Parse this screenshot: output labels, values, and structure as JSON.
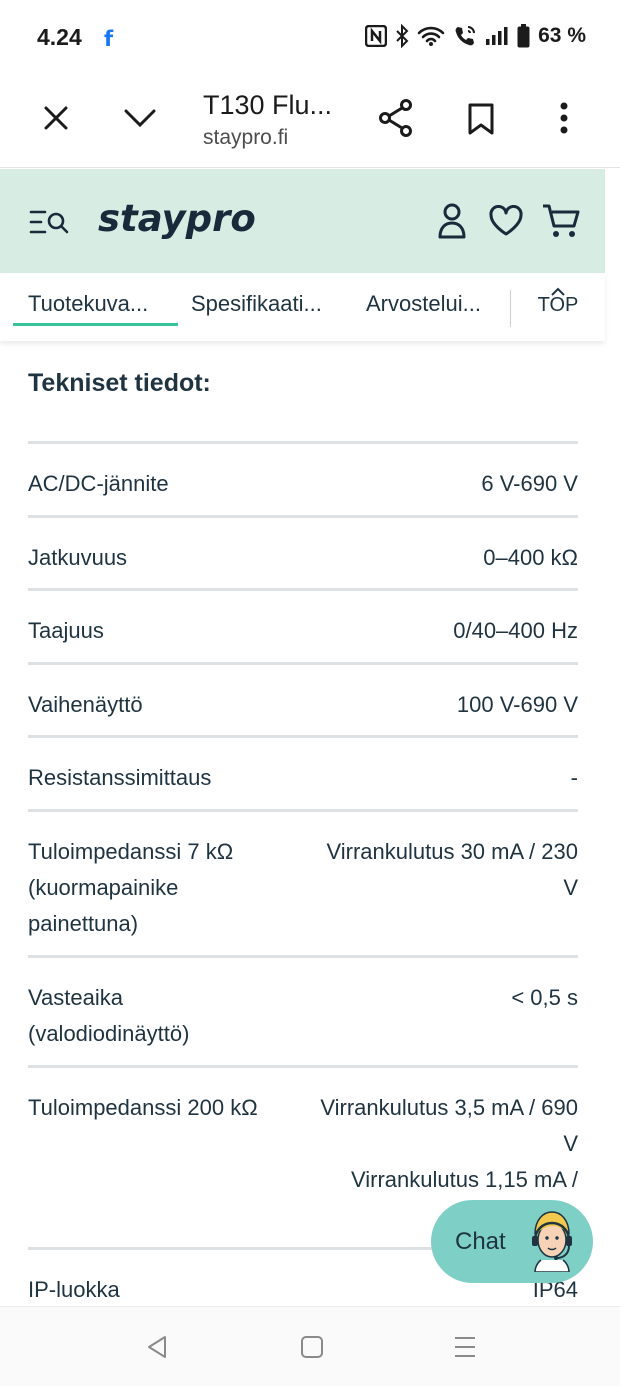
{
  "status_bar": {
    "time": "4.24",
    "app_icon": "facebook-icon",
    "battery": "63 %",
    "icons": [
      "nfc-icon",
      "bluetooth-icon",
      "wifi-icon",
      "wifi-calling-icon",
      "signal-icon",
      "battery-icon"
    ]
  },
  "browser": {
    "title": "T130 Flu...",
    "domain": "staypro.fi",
    "icons": [
      "close-icon",
      "chevron-down-icon",
      "share-icon",
      "bookmark-icon",
      "more-icon"
    ]
  },
  "site": {
    "logo": "staypro",
    "icons": [
      "menu-search-icon",
      "user-icon",
      "heart-icon",
      "cart-icon"
    ],
    "accent": "#37c49a",
    "header_bg": "#d7ece2"
  },
  "tabs": [
    {
      "label": "Tuotekuva..."
    },
    {
      "label": "Spesifikaati..."
    },
    {
      "label": "Arvostelui..."
    }
  ],
  "top_button": "TOP",
  "section_title": "Tekniset tiedot:",
  "specs": [
    {
      "label": "AC/DC-jännite",
      "value": "6 V-690 V"
    },
    {
      "label": "Jatkuvuus",
      "value": "0–400 kΩ"
    },
    {
      "label": "Taajuus",
      "value": "0/40–400 Hz"
    },
    {
      "label": "Vaihenäyttö",
      "value": "100 V-690 V"
    },
    {
      "label": "Resistanssimittaus",
      "value": "-"
    },
    {
      "label": "Tuloimpedanssi 7 kΩ (kuormapainike painettuna)",
      "value": "Virrankulutus 30 mA / 230 V"
    },
    {
      "label": "Vasteaika (valodiodinäyttö)",
      "value": "< 0,5 s"
    },
    {
      "label": "Tuloimpedanssi 200 kΩ",
      "value": "Virrankulutus 3,5 mA / 690 V",
      "value2": "Virrankulutus 1,15 mA /"
    },
    {
      "label": "IP-luokka",
      "value": "IP64"
    }
  ],
  "chat": {
    "label": "Chat",
    "icon": "support-agent-avatar"
  },
  "nav_bar": {
    "icons": [
      "back-icon",
      "home-icon",
      "recents-icon"
    ]
  }
}
